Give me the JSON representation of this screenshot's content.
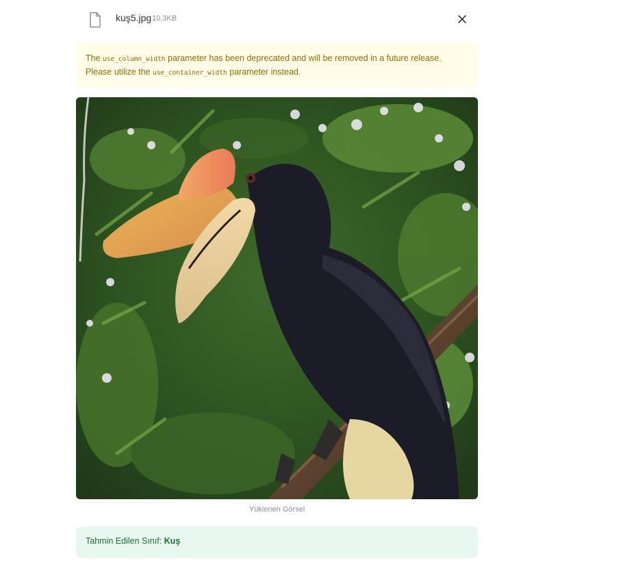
{
  "uploaded_file": {
    "name": "kuş5.jpg",
    "size": "10.3KB",
    "icon": "file-icon",
    "close_icon": "close-icon"
  },
  "warning": {
    "text_1": "The ",
    "code_1": "use_column_width",
    "text_2": " parameter has been deprecated and will be removed in a future release. Please utilize the ",
    "code_2": "use_container_width",
    "text_3": " parameter instead."
  },
  "image": {
    "caption": "Yüklenen Görsel"
  },
  "result": {
    "label": "Tahmin Edilen Sınıf: ",
    "value": "Kuş"
  },
  "colors": {
    "warning_bg": "#fffce7",
    "warning_text": "#926c05",
    "success_bg": "#e9f8ee",
    "success_text": "#177233"
  }
}
